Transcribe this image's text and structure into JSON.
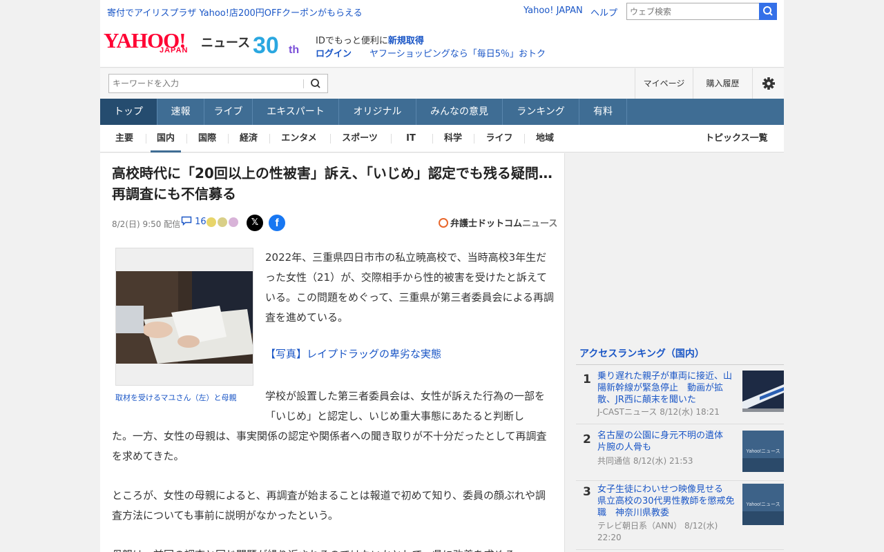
{
  "topbar": {
    "promo": "寄付でアイリスプラザ Yahoo!店200円OFFクーポンがもらえる",
    "yahoo_japan": "Yahoo! JAPAN",
    "help": "ヘルプ",
    "web_search_placeholder": "ウェブ検索"
  },
  "logo": {
    "yahoo": "YAHOO!",
    "japan": "JAPAN",
    "news": "ニュース",
    "anniversary": "30th"
  },
  "account": {
    "id_prefix": "IDでもっと便利に",
    "register": "新規取得",
    "login": "ログイン",
    "shopping_promo": "ヤフーショッピングなら「毎日5％」おトク"
  },
  "search": {
    "placeholder": "キーワードを入力",
    "mypage": "マイページ",
    "history": "購入履歴"
  },
  "main_nav": [
    "トップ",
    "速報",
    "ライブ",
    "エキスパート",
    "オリジナル",
    "みんなの意見",
    "ランキング",
    "有料"
  ],
  "sub_nav": [
    "主要",
    "国内",
    "国際",
    "経済",
    "エンタメ",
    "スポーツ",
    "IT",
    "科学",
    "ライフ",
    "地域"
  ],
  "topics_list": "トピックス一覧",
  "article": {
    "headline": "高校時代に「20回以上の性被害」訴え、「いじめ」認定でも残る疑問…再調査にも不信募る",
    "date": "8/2(日) 9:50 配信",
    "comment_count": "16",
    "source_name": "弁護士ドットコム",
    "source_suffix": "ニュース",
    "caption": "取材を受けるマユさん（左）と母親",
    "p1": "2022年、三重県四日市市の私立暁高校で、当時高校3年生だった女性（21）が、交際相手から性的被害を受けたと訴えている。この問題をめぐって、三重県が第三者委員会による再調査を進めている。",
    "photo_link": "【写真】レイプドラッグの卑劣な実態",
    "p2a": "学校が設置した第三者委員会は、女性が訴えた行為の一部を「いじめ」と認定し、いじめ重大事態にあたると判断し",
    "p2b": "た。一方、女性の母親は、事実関係の認定や関係者への聞き取りが不十分だったとして再調査を求めてきた。",
    "p3": "ところが、女性の母親によると、再調査が始まることは報道で初めて知り、委員の顔ぶれや調査方法についても事前に説明がなかったという。",
    "p4": "母親は、前回の調査と同じ問題が繰り返されるのではないかとして、県に改善を求める"
  },
  "ranking": {
    "title": "アクセスランキング（国内）",
    "items": [
      {
        "rank": "1",
        "headline": "乗り遅れた親子が車両に接近、山陽新幹線が緊急停止　動画が拡散、JR西に顛末を聞いた",
        "source": "J-CASTニュース 8/12(水) 18:21"
      },
      {
        "rank": "2",
        "headline": "名古屋の公園に身元不明の遺体　片腕の人骨も",
        "source": "共同通信 8/12(水) 21:53"
      },
      {
        "rank": "3",
        "headline": "女子生徒にわいせつ映像見せる　県立高校の30代男性教師を懲戒免職　神奈川県教委",
        "source": "テレビ朝日系（ANN） 8/12(水) 22:20"
      }
    ],
    "thumb_logo": "Yahoo!ニュース"
  },
  "colors": {
    "brand_red": "#ff0033",
    "nav_blue": "#3f6d94",
    "link_blue": "#1a56c6"
  }
}
